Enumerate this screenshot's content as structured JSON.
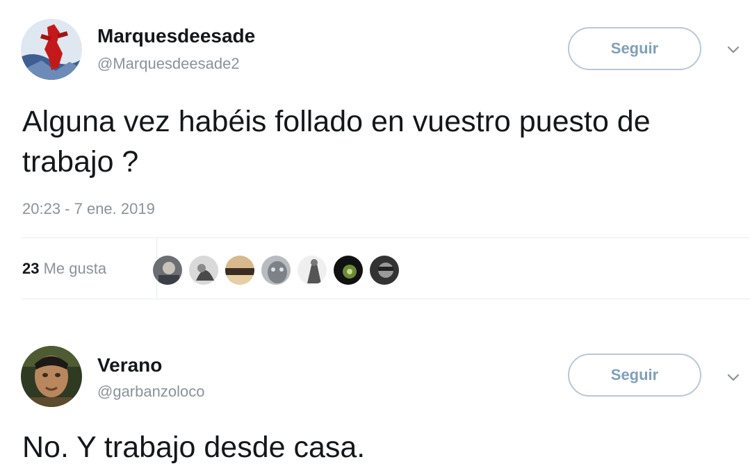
{
  "tweets": [
    {
      "name": "Marquesdeesade",
      "handle": "@Marquesdeesade2",
      "follow_label": "Seguir",
      "text": "Alguna vez habéis follado en vuestro puesto de trabajo ?",
      "timestamp": "20:23 - 7 ene. 2019",
      "likes_count": "23",
      "likes_label": "Me gusta",
      "avatar_icon": "red-figure-avatar-icon"
    },
    {
      "name": "Verano",
      "handle": "@garbanzoloco",
      "follow_label": "Seguir",
      "text": "No. Y trabajo desde casa.",
      "avatar_icon": "man-portrait-avatar-icon"
    }
  ],
  "colors": {
    "text": "#14171a",
    "muted": "#8a9299",
    "follow_border": "#b9c7d3",
    "follow_text": "#7f9fb8",
    "divider": "#e6ecf0"
  }
}
